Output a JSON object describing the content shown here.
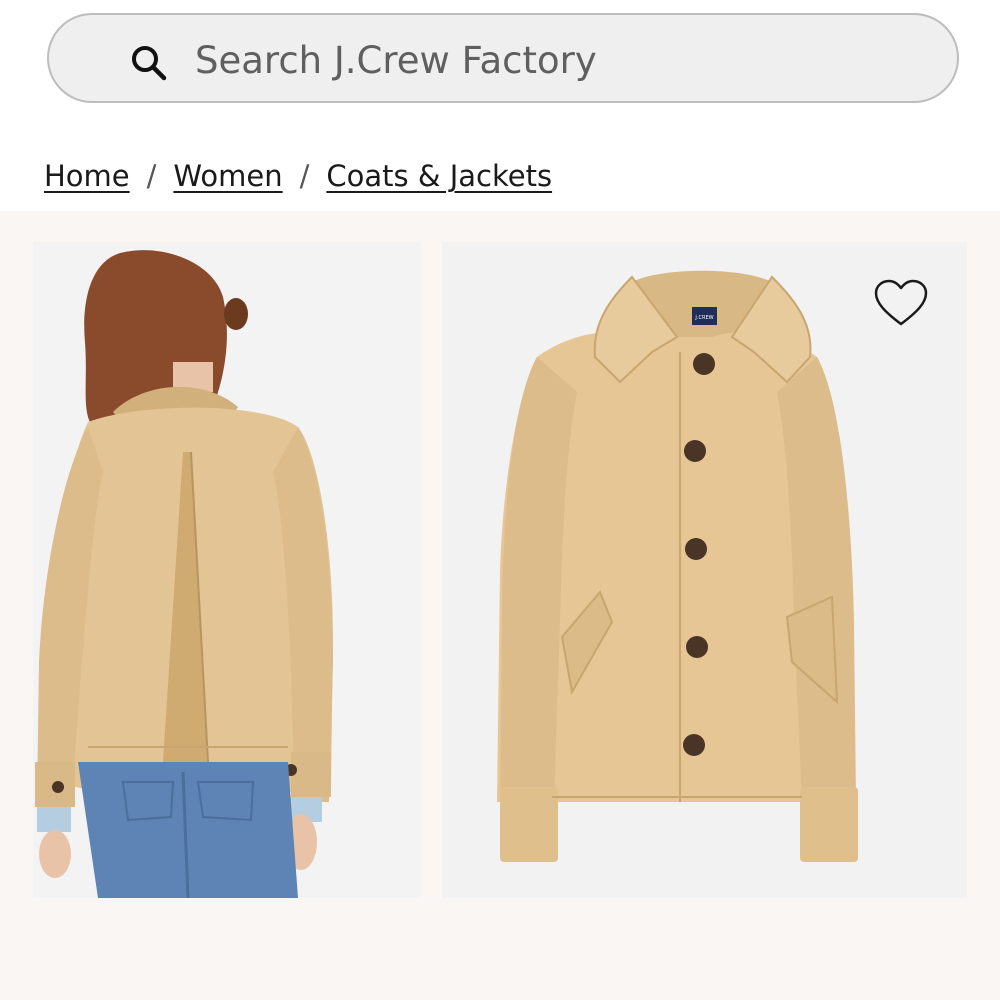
{
  "search": {
    "placeholder": "Search J.Crew Factory",
    "icon": "search-icon"
  },
  "breadcrumb": {
    "items": [
      {
        "label": "Home"
      },
      {
        "label": "Women"
      },
      {
        "label": "Coats & Jackets"
      }
    ],
    "separator": "/"
  },
  "gallery": {
    "images": [
      {
        "name": "product-image-back",
        "description_hidden": true
      },
      {
        "name": "product-image-front",
        "description_hidden": true
      }
    ],
    "wishlist_icon": "heart-icon"
  },
  "colors": {
    "jacket": "#e5c694",
    "jacket_shade": "#cfab72",
    "button": "#4a3426",
    "denim": "#5d84b4",
    "gallery_bg": "#faf6f4"
  },
  "brand_label": "J.CREW"
}
